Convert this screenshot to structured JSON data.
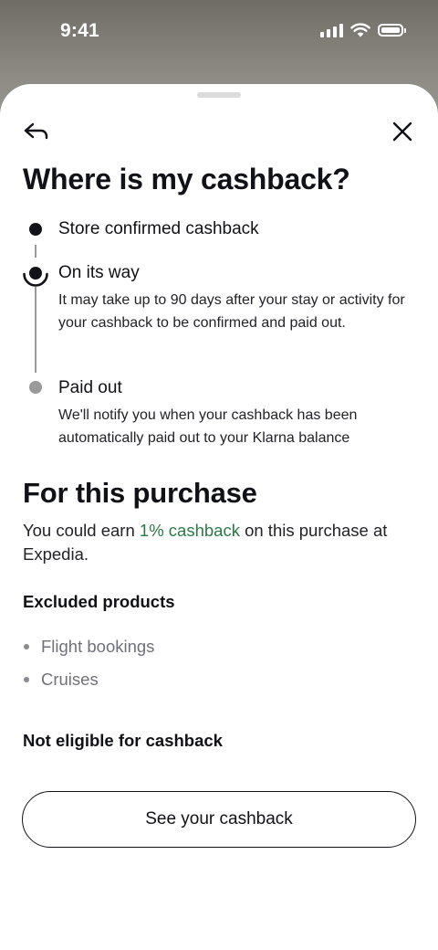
{
  "status_bar": {
    "time": "9:41",
    "icons": [
      "cellular-signal-icon",
      "wifi-icon",
      "battery-icon"
    ]
  },
  "sheet": {
    "icons": {
      "back": "back-arrow-icon",
      "close": "close-icon"
    },
    "title": "Where is my cashback?",
    "timeline": [
      {
        "label": "Store confirmed cashback",
        "status": "done"
      },
      {
        "label": "On its way",
        "status": "current",
        "description": "It may take up to 90 days after your stay or activity for your cashback to be confirmed and paid out."
      },
      {
        "label": "Paid out",
        "status": "pending",
        "description": "We'll notify you when your cashback has been automatically paid out to your Klarna balance"
      }
    ],
    "purchase": {
      "heading": "For this purchase",
      "text_before": "You could earn ",
      "highlight": "1% cashback",
      "text_after": " on this purchase at Expedia."
    },
    "excluded": {
      "heading": "Excluded products",
      "items": [
        "Flight bookings",
        "Cruises"
      ]
    },
    "not_eligible": "Not eligible for cashback",
    "cta_label": "See your cashback"
  },
  "colors": {
    "text": "#111118",
    "highlight_green": "#2a7a46",
    "muted_grey": "#9a9a9a",
    "sheet_bg": "#ffffff"
  }
}
